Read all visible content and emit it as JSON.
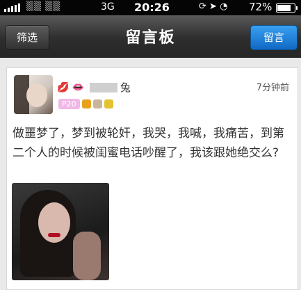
{
  "status_bar": {
    "network": "3G",
    "time": "20:26",
    "battery": "72%"
  },
  "navbar": {
    "filter_label": "筛选",
    "title": "留言板",
    "post_label": "留言"
  },
  "post": {
    "username_suffix": "兔",
    "time_ago": "7分钟前",
    "level_badge": "P20",
    "content": "做噩梦了，梦到被轮奸，我哭，我喊，我痛苦，到第二个人的时候被闺蜜电话吵醒了，我该跟她绝交么?"
  },
  "colors": {
    "navbar_dark": "#2e2e2e",
    "post_button": "#1f84dd",
    "level_badge": "#f1b7e6"
  }
}
